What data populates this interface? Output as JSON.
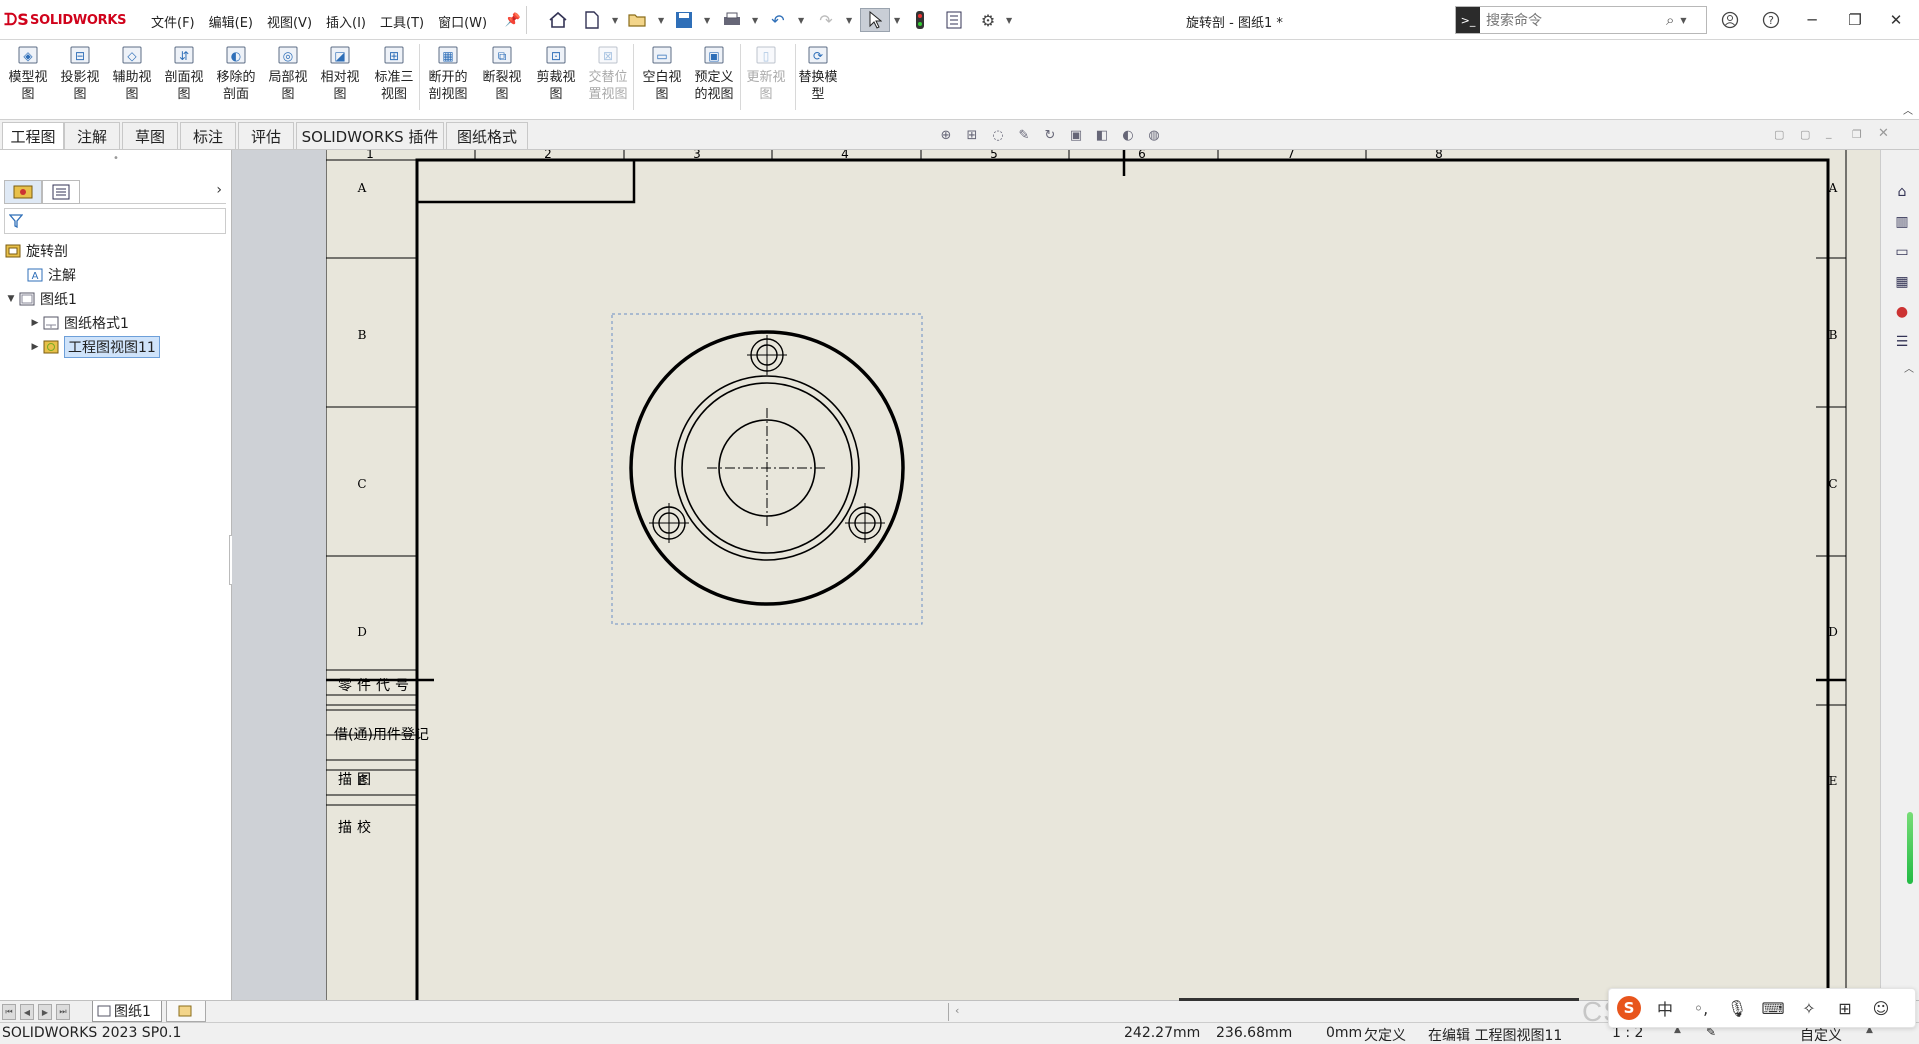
{
  "app": {
    "brand": "SOLIDWORKS",
    "document_title": "旋转剖 - 图纸1 *",
    "search_placeholder": "搜索命令"
  },
  "menus": [
    "文件(F)",
    "编辑(E)",
    "视图(V)",
    "插入(I)",
    "工具(T)",
    "窗口(W)"
  ],
  "ribbon": [
    {
      "label": "模型视\n图",
      "icon": "model-view-icon",
      "enabled": true
    },
    {
      "label": "投影视\n图",
      "icon": "projected-view-icon",
      "enabled": true
    },
    {
      "label": "辅助视\n图",
      "icon": "auxiliary-view-icon",
      "enabled": true
    },
    {
      "label": "剖面视\n图",
      "icon": "section-view-icon",
      "enabled": true
    },
    {
      "label": "移除的\n剖面",
      "icon": "removed-section-icon",
      "enabled": true
    },
    {
      "label": "局部视\n图",
      "icon": "detail-view-icon",
      "enabled": true
    },
    {
      "label": "相对视\n图",
      "icon": "relative-view-icon",
      "enabled": true
    },
    {
      "label": "标准三\n视图",
      "icon": "standard-3view-icon",
      "enabled": true
    },
    {
      "label": "断开的\n剖视图",
      "icon": "broken-out-section-icon",
      "enabled": true
    },
    {
      "label": "断裂视\n图",
      "icon": "break-view-icon",
      "enabled": true
    },
    {
      "label": "剪裁视\n图",
      "icon": "crop-view-icon",
      "enabled": true
    },
    {
      "label": "交替位\n置视图",
      "icon": "alternate-position-icon",
      "enabled": false
    },
    {
      "label": "空白视\n图",
      "icon": "empty-view-icon",
      "enabled": true
    },
    {
      "label": "预定义\n的视图",
      "icon": "predefined-view-icon",
      "enabled": true
    },
    {
      "label": "更新视\n图",
      "icon": "update-view-icon",
      "enabled": false
    },
    {
      "label": "替换模\n型",
      "icon": "replace-model-icon",
      "enabled": true
    }
  ],
  "tabs": [
    "工程图",
    "注解",
    "草图",
    "标注",
    "评估",
    "SOLIDWORKS 插件",
    "图纸格式"
  ],
  "active_tab": "工程图",
  "tree": {
    "root": "旋转剖",
    "annotations": "注解",
    "sheet": "图纸1",
    "sheet_format": "图纸格式1",
    "drawing_view": "工程图视图11"
  },
  "drawing": {
    "zone_columns": [
      "1",
      "2",
      "3",
      "4",
      "5",
      "6",
      "7",
      "8"
    ],
    "zone_rows": [
      "A",
      "B",
      "C",
      "D",
      "E"
    ],
    "title_block_labels": [
      "零件代号",
      "借(通)用件登记",
      "描图",
      "描校"
    ]
  },
  "sheet_tabs": {
    "current": "图纸1"
  },
  "status": {
    "version": "SOLIDWORKS 2023 SP0.1",
    "x": "242.27mm",
    "y": "236.68mm",
    "z": "0mm",
    "constraint": "欠定义",
    "editing": "在编辑 工程图视图11",
    "scale": "1 : 2",
    "units": "自定义"
  },
  "colors": {
    "sheet_bg": "#e8e6db",
    "brand_red": "#d0021b",
    "selection_blue": "#cfe3fa"
  },
  "watermark": "CSDN @已熬伏了字"
}
